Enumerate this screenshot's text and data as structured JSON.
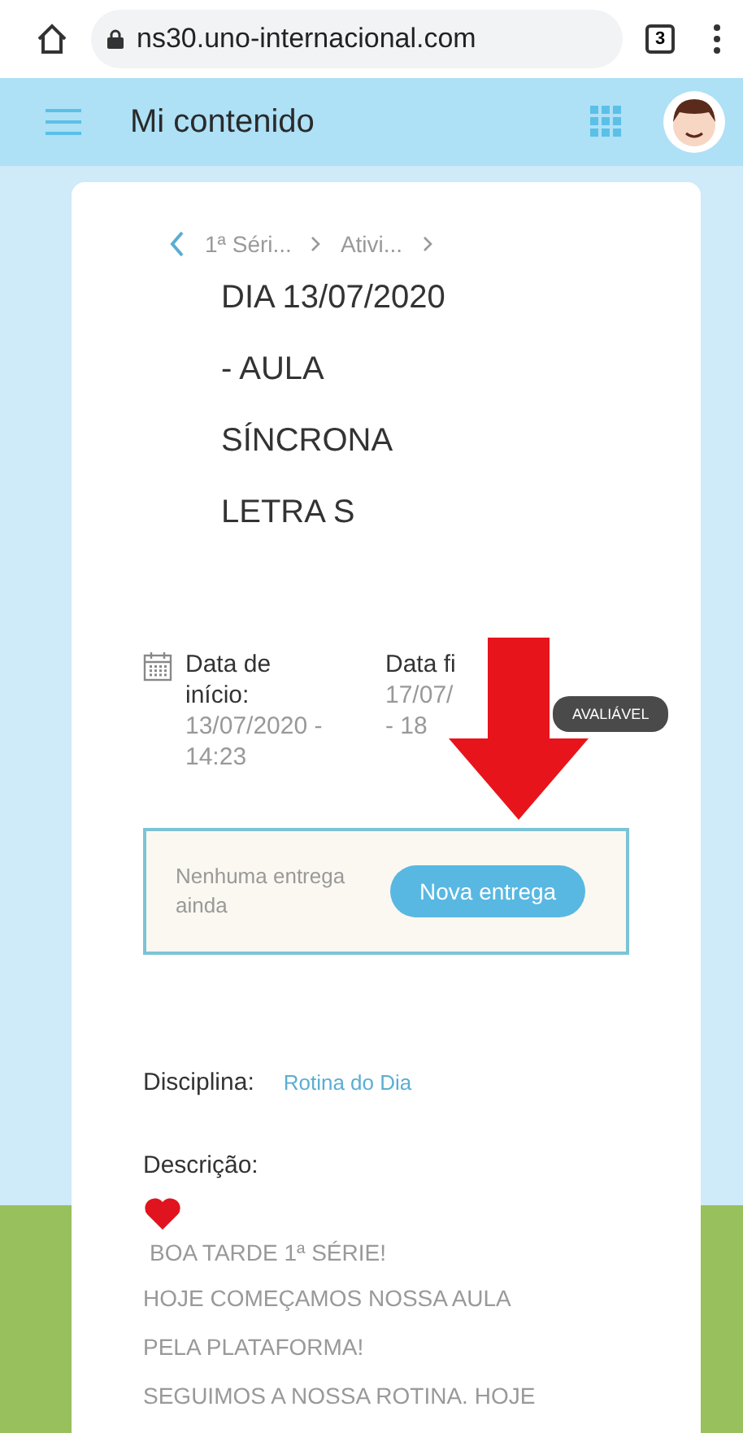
{
  "browser": {
    "url": "ns30.uno-internacional.com",
    "tab_count": "3"
  },
  "header": {
    "title": "Mi contenido"
  },
  "breadcrumb": [
    "1ª Séri...",
    "Ativi..."
  ],
  "title_lines": [
    "DIA 13/07/2020",
    "- AULA",
    "SÍNCRONA",
    "LETRA S"
  ],
  "dates": [
    {
      "label": "Data de início:",
      "value": "13/07/2020 - 14:23"
    },
    {
      "label": "Data fi",
      "value_lines": [
        "17/07/",
        "- 18"
      ]
    }
  ],
  "badge": "AVALIÁVEL",
  "delivery": {
    "message": "Nenhuma entrega ainda",
    "button": "Nova entrega"
  },
  "subject": {
    "label": "Disciplina:",
    "value": "Rotina do Dia"
  },
  "description": {
    "label": "Descrição:",
    "lines": [
      "BOA TARDE 1ª SÉRIE!",
      "HOJE COMEÇAMOS NOSSA AULA",
      "PELA PLATAFORMA!",
      "SEGUIMOS A NOSSA ROTINA. HOJE"
    ]
  }
}
